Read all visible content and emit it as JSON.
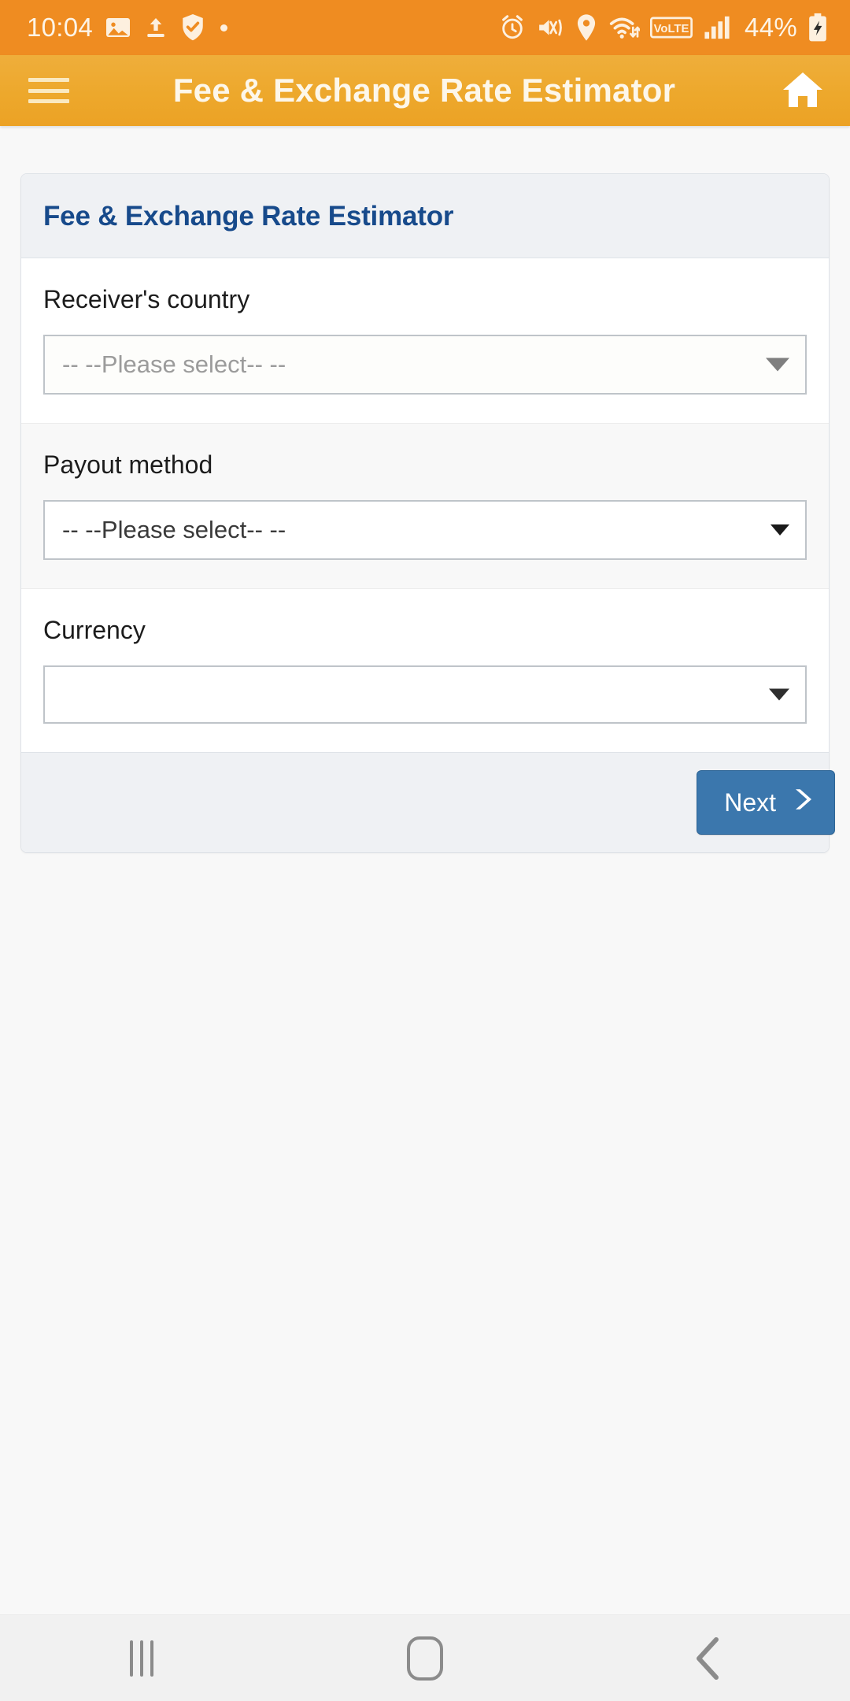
{
  "status_bar": {
    "time": "10:04",
    "battery_percent": "44%",
    "left_icons": [
      "photo-icon",
      "upload-icon",
      "shield-check-icon",
      "dot-indicator"
    ],
    "right_icons": [
      "alarm-icon",
      "mute-vibrate-icon",
      "location-icon",
      "wifi-icon",
      "volte-icon",
      "signal-bars-icon",
      "battery-charging-icon"
    ],
    "volte_label": "VoLTE",
    "background_color": "#ef8c21"
  },
  "app_bar": {
    "title": "Fee & Exchange Rate Estimator",
    "menu_icon": "hamburger-icon",
    "home_icon": "home-icon",
    "background_color": "#eda82c",
    "text_color": "#fdf7ea"
  },
  "panel": {
    "heading": "Fee & Exchange Rate Estimator",
    "heading_color": "#174a8b",
    "header_background": "#eff1f4",
    "fields": [
      {
        "label": "Receiver's country",
        "value": "-- --Please select-- --",
        "placeholder": "-- --Please select-- --",
        "state": "placeholder"
      },
      {
        "label": "Payout method",
        "value": "-- --Please select-- --",
        "placeholder": "-- --Please select-- --",
        "state": "selected"
      },
      {
        "label": "Currency",
        "value": "",
        "placeholder": "",
        "state": "empty"
      }
    ],
    "footer": {
      "next_label": "Next",
      "next_icon": "chevron-right-icon",
      "next_color": "#3b77ad"
    }
  },
  "nav_bar": {
    "recents_label": "recents-icon",
    "home_label": "home-icon",
    "back_label": "back-icon",
    "background_color": "#f1f1f1"
  }
}
